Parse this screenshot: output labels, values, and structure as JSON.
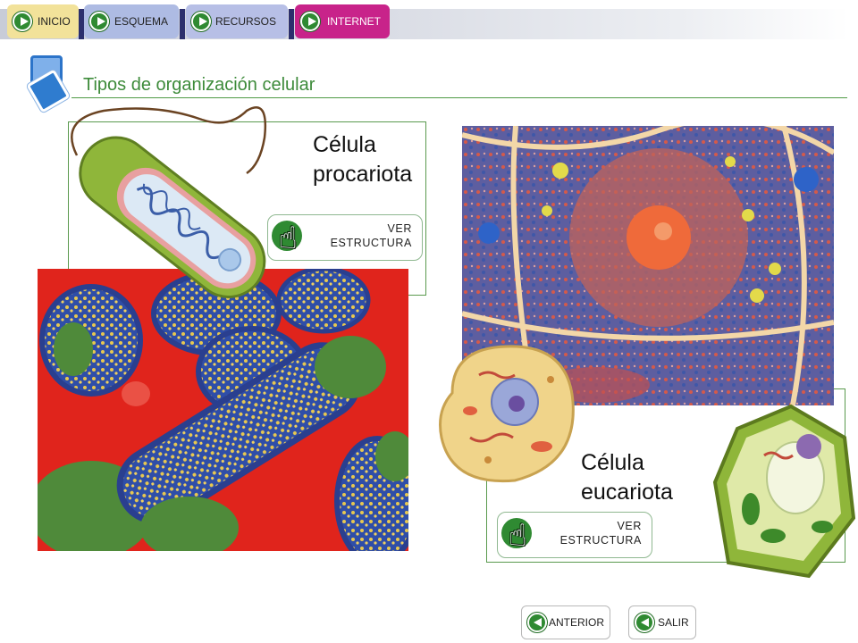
{
  "nav": {
    "items": [
      {
        "label": "INICIO",
        "color": "#f2e29a"
      },
      {
        "label": "ESQUEMA",
        "color": "#aebbe3"
      },
      {
        "label": "RECURSOS",
        "color": "#b7bfe6"
      },
      {
        "label": "INTERNET",
        "color": "#c8238a"
      }
    ]
  },
  "header": {
    "title": "Tipos de organización celular",
    "title_color": "#3d8b3a"
  },
  "procariota": {
    "name_line1": "Célula",
    "name_line2": "procariota",
    "button_line1": "VER",
    "button_line2": "ESTRUCTURA"
  },
  "eucariota": {
    "name_line1": "Célula",
    "name_line2": "eucariota",
    "button_line1": "VER",
    "button_line2": "ESTRUCTURA"
  },
  "footer": {
    "anterior": "ANTERIOR",
    "salir": "SALIR"
  },
  "colors": {
    "accent_green": "#2f8a32",
    "border_green": "#5a9a4e",
    "bacteria_red": "#e0241c",
    "bacteria_blue": "#2f4ea8"
  }
}
